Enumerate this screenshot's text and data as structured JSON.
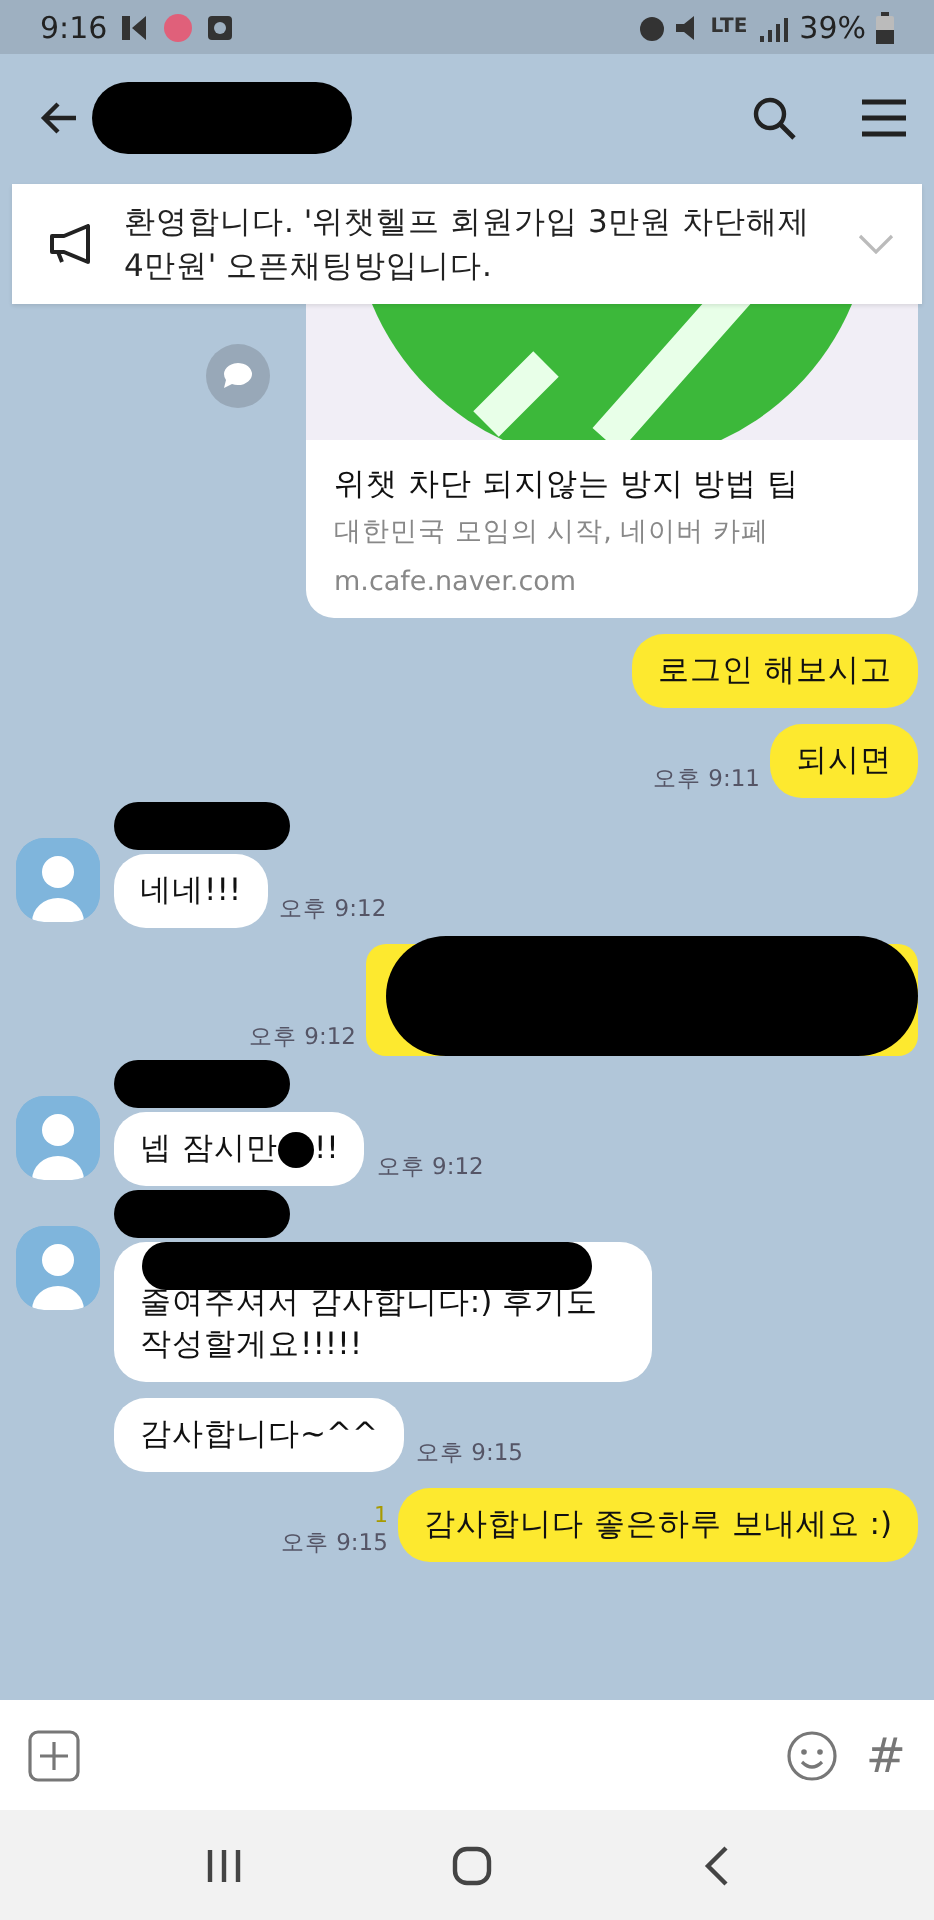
{
  "status_bar": {
    "time": "9:16",
    "network": "LTE",
    "battery": "39%"
  },
  "notice": {
    "text": "환영합니다. '위챗헬프 회원가입 3만원 차단해제 4만원' 오픈채팅방입니다."
  },
  "messages": [
    {
      "kind": "link",
      "title": "위챗 차단 되지않는 방지 방법 팁",
      "subtitle": "대한민국 모임의 시작, 네이버 카페",
      "url": "m.cafe.naver.com"
    },
    {
      "kind": "sent",
      "text": "로그인 해보시고"
    },
    {
      "kind": "sent",
      "text": "되시면",
      "time": "오후 9:11"
    },
    {
      "kind": "received",
      "text": "네네!!!",
      "time": "오후 9:12"
    },
    {
      "kind": "sent_redacted",
      "time": "오후 9:12"
    },
    {
      "kind": "received",
      "parts": [
        "넵 잠시만",
        "!!"
      ],
      "time": "오후 9:12"
    },
    {
      "kind": "received_covered",
      "text": "줄여주셔서 감사합니다:) 후기도 작성할게요!!!!!"
    },
    {
      "kind": "received_more",
      "text": "감사합니다~^^",
      "time": "오후 9:15"
    },
    {
      "kind": "sent",
      "text": "감사합니다 좋은하루 보내세요 :)",
      "unread": "1",
      "time": "오후 9:15"
    }
  ],
  "input_bar": {
    "hash": "#"
  }
}
